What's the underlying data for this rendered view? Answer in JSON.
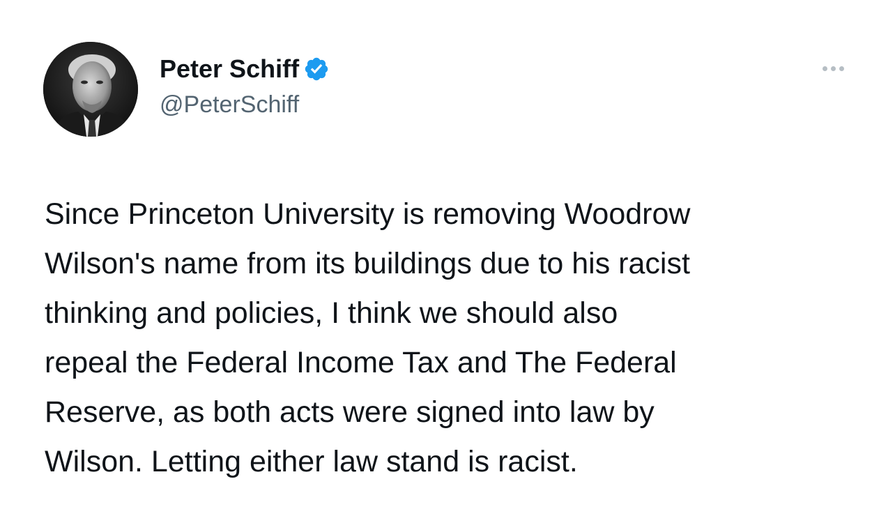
{
  "author": {
    "display_name": "Peter Schiff",
    "handle": "@PeterSchiff",
    "verified": true,
    "verified_badge_color": "#1d9bf0",
    "avatar_icon": "profile-photo"
  },
  "menu": {
    "icon": "more-options-icon"
  },
  "tweet": {
    "lines": [
      "Since Princeton University is removing Woodrow",
      "Wilson's name from its buildings due to his racist",
      "thinking and policies, I think we should also",
      "repeal the Federal Income Tax and The Federal",
      "Reserve, as both acts were signed into law by",
      "Wilson. Letting either law stand is racist."
    ]
  }
}
